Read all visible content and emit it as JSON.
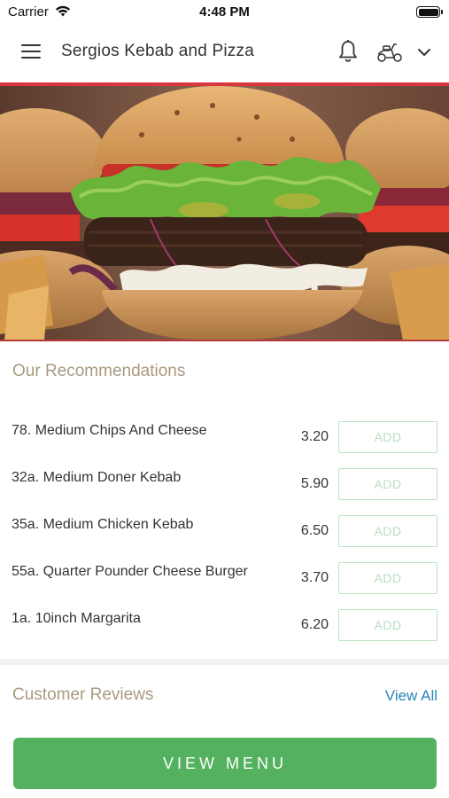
{
  "status_bar": {
    "carrier": "Carrier",
    "time": "4:48 PM"
  },
  "header": {
    "title": "Sergios Kebab and Pizza",
    "icons": [
      "menu-icon",
      "bell-icon",
      "scooter-icon",
      "chevron-down-icon"
    ],
    "accent_color": "#d9363e"
  },
  "recommendations": {
    "title": "Our Recommendations",
    "items": [
      {
        "name": "78. Medium Chips And Cheese",
        "price": "3.20",
        "add_label": "ADD"
      },
      {
        "name": "32a. Medium Doner Kebab",
        "price": "5.90",
        "add_label": "ADD"
      },
      {
        "name": "35a. Medium Chicken Kebab",
        "price": "6.50",
        "add_label": "ADD"
      },
      {
        "name": "55a. Quarter Pounder Cheese Burger",
        "price": "3.70",
        "add_label": "ADD"
      },
      {
        "name": "1a. 10inch Margarita",
        "price": "6.20",
        "add_label": "ADD"
      }
    ]
  },
  "reviews": {
    "title": "Customer Reviews",
    "view_all_label": "View All"
  },
  "footer": {
    "view_menu_label": "VIEW MENU",
    "button_color": "#54b15f"
  }
}
